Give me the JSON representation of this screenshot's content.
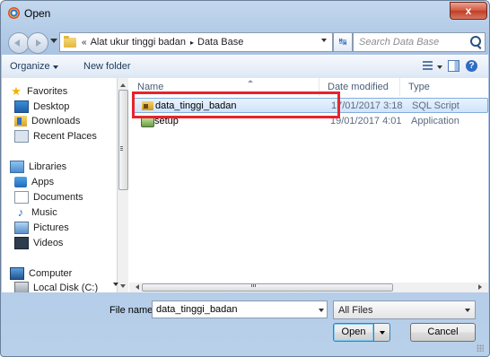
{
  "window": {
    "title": "Open",
    "close_glyph": "x"
  },
  "address": {
    "chevrons": "«",
    "crumbs": [
      "Alat ukur tinggi badan",
      "Data Base"
    ],
    "separator": "▸",
    "refresh_glyph": "↹"
  },
  "search": {
    "placeholder": "Search Data Base"
  },
  "toolbar": {
    "organize_label": "Organize",
    "new_folder_label": "New folder",
    "help_glyph": "?"
  },
  "nav_pane": {
    "favorites": {
      "label": "Favorites",
      "items": [
        "Desktop",
        "Downloads",
        "Recent Places"
      ]
    },
    "libraries": {
      "label": "Libraries",
      "items": [
        "Apps",
        "Documents",
        "Music",
        "Pictures",
        "Videos"
      ]
    },
    "computer": {
      "label": "Computer",
      "items": [
        "Local Disk (C:)"
      ]
    }
  },
  "columns": {
    "name": "Name",
    "date_modified": "Date modified",
    "type": "Type"
  },
  "files": [
    {
      "name": "data_tinggi_badan",
      "date": "17/01/2017 3:18",
      "type": "SQL Script",
      "icon": "sql-script-icon",
      "selected": true
    },
    {
      "name": "setup",
      "date": "19/01/2017 4:01",
      "type": "Application",
      "icon": "setup-icon",
      "selected": false
    }
  ],
  "bottom": {
    "file_name_label": "File name:",
    "file_name_value": "data_tinggi_badan",
    "file_type_value": "All Files",
    "open_label": "Open",
    "cancel_label": "Cancel"
  },
  "colors": {
    "highlight_box": "#e8232b",
    "selection": "#cfe4fb"
  }
}
